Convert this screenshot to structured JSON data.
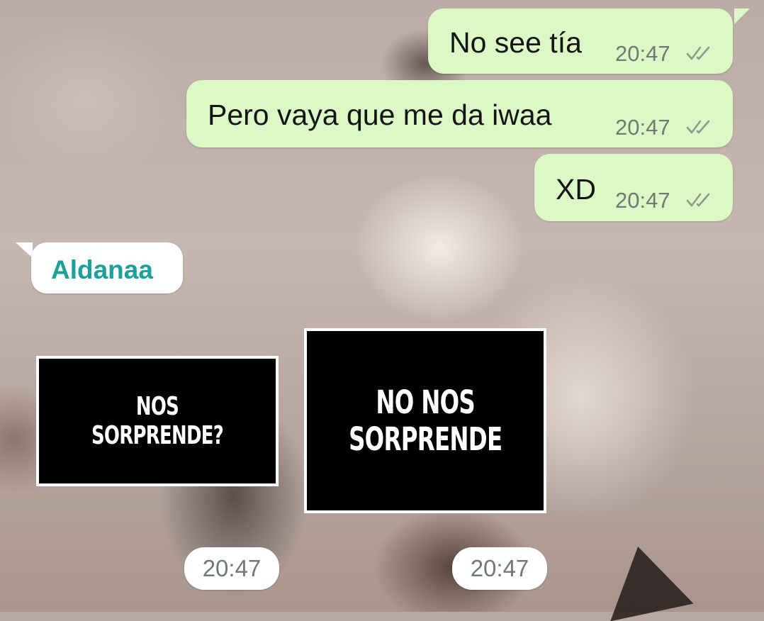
{
  "outgoing_messages": [
    {
      "text": "No see tía",
      "time": "20:47",
      "status_icon": "double-check-icon"
    },
    {
      "text": "Pero vaya que me da iwaa",
      "time": "20:47",
      "status_icon": "double-check-icon"
    },
    {
      "text": "XD",
      "time": "20:47",
      "status_icon": "double-check-icon"
    }
  ],
  "incoming": {
    "sender_name": "Aldanaa",
    "stickers": [
      {
        "text": "NOS SORPRENDE?",
        "time": "20:47"
      },
      {
        "text": "NO NOS\nSORPRENDE",
        "time": "20:47"
      }
    ]
  },
  "colors": {
    "outgoing_bubble": "#dcf8c6",
    "incoming_bubble": "#ffffff",
    "sender_name": "#1ba19a",
    "timestamp": "#6d7b72",
    "read_ticks": "#8a9a90"
  }
}
